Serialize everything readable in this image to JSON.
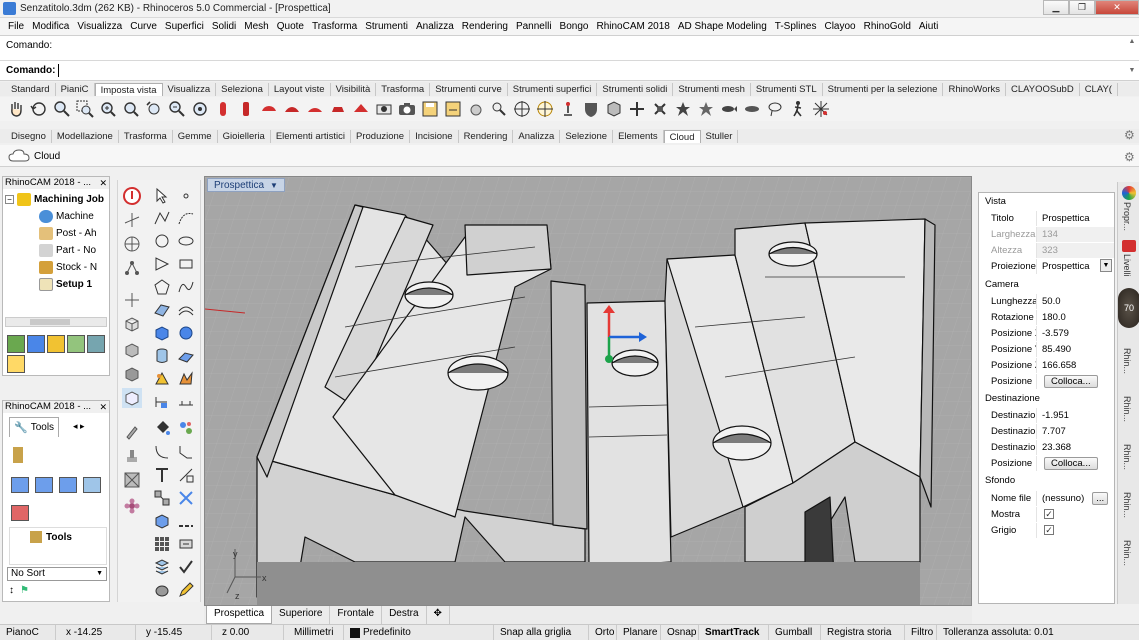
{
  "window": {
    "title": "Senzatitolo.3dm (262 KB) - Rhinoceros 5.0 Commercial - [Prospettica]"
  },
  "menu": [
    "File",
    "Modifica",
    "Visualizza",
    "Curve",
    "Superfici",
    "Solidi",
    "Mesh",
    "Quote",
    "Trasforma",
    "Strumenti",
    "Analizza",
    "Rendering",
    "Pannelli",
    "Bongo",
    "RhinoCAM 2018",
    "AD Shape Modeling",
    "T-Splines",
    "Clayoo",
    "RhinoGold",
    "Aiuti"
  ],
  "command": {
    "history": "Comando:",
    "prompt": "Comando:"
  },
  "toolbar_tabs": [
    "Standard",
    "PianiC",
    "Imposta vista",
    "Visualizza",
    "Seleziona",
    "Layout viste",
    "Visibilità",
    "Trasforma",
    "Strumenti curve",
    "Strumenti superfici",
    "Strumenti solidi",
    "Strumenti mesh",
    "Strumenti STL",
    "Strumenti per la selezione",
    "RhinoWorks",
    "CLAYOOSubD",
    "CLAY("
  ],
  "toolbar_tabs_active": "Imposta vista",
  "toolbar_tabs2": [
    "Disegno",
    "Modellazione",
    "Trasforma",
    "Gemme",
    "Gioielleria",
    "Elementi artistici",
    "Produzione",
    "Incisione",
    "Rendering",
    "Analizza",
    "Selezione",
    "Elements",
    "Cloud",
    "Stuller"
  ],
  "toolbar_tabs2_active": "Cloud",
  "cloud": {
    "label": "Cloud"
  },
  "left_panel_top": {
    "title": "RhinoCAM 2018 - ...",
    "tree": [
      {
        "label": "Machining Job",
        "bold": true
      },
      {
        "label": "Machine"
      },
      {
        "label": "Post - Ah"
      },
      {
        "label": "Part - No"
      },
      {
        "label": "Stock - N"
      },
      {
        "label": "Setup 1",
        "bold": true
      }
    ]
  },
  "left_panel_bottom": {
    "title": "RhinoCAM 2018 - ...",
    "tab": "Tools",
    "tree_label": "Tools",
    "sort": "No Sort"
  },
  "viewport": {
    "name": "Prospettica",
    "axis_y": "y",
    "axis_x": "x",
    "axis_z": "z"
  },
  "viewport_tabs": [
    "Prospettica",
    "Superiore",
    "Frontale",
    "Destra"
  ],
  "viewport_tabs_active": "Prospettica",
  "properties": {
    "section_vista": "Vista",
    "titolo_k": "Titolo",
    "titolo_v": "Prospettica",
    "larghezza_k": "Larghezza",
    "larghezza_v": "134",
    "altezza_k": "Altezza",
    "altezza_v": "323",
    "proiezione_k": "Proiezione",
    "proiezione_v": "Prospettica",
    "section_camera": "Camera",
    "lunghezza_k": "Lunghezza ...",
    "lunghezza_v": "50.0",
    "rotazione_k": "Rotazione",
    "rotazione_v": "180.0",
    "posx_k": "Posizione X",
    "posx_v": "-3.579",
    "posy_k": "Posizione Y",
    "posy_v": "85.490",
    "posz_k": "Posizione Z",
    "posz_v": "166.658",
    "pos_k": "Posizione",
    "pos_btn": "Colloca...",
    "section_dest": "Destinazione",
    "destx_k": "Destinazion...",
    "destx_v": "-1.951",
    "desty_k": "Destinazion...",
    "desty_v": "7.707",
    "destz_k": "Destinazion...",
    "destz_v": "23.368",
    "dpos_k": "Posizione",
    "dpos_btn": "Colloca...",
    "section_sfondo": "Sfondo",
    "file_k": "Nome file",
    "file_v": "(nessuno)",
    "file_btn": "...",
    "mostra_k": "Mostra",
    "grigio_k": "Grigio"
  },
  "right_strip": [
    "Propr...",
    "Livelli",
    "Rhin...",
    "Rhin...",
    "Rhin...",
    "Rhin...",
    "Rhin..."
  ],
  "right_strip_badge": "70",
  "status": {
    "plane": "PianoC",
    "x": "x -14.25",
    "y": "y -15.45",
    "z": "z 0.00",
    "units": "Millimetri",
    "layer": "Predefinito",
    "snap": "Snap alla griglia",
    "orto": "Orto",
    "planare": "Planare",
    "osnap": "Osnap",
    "smarttrack": "SmartTrack",
    "gumball": "Gumball",
    "history": "Registra storia",
    "filtro": "Filtro",
    "tolerance": "Tolleranza assoluta: 0.01"
  },
  "colors": {
    "viewport_bg": "#9e9e9e",
    "gumball_x": "#e53935",
    "gumball_y": "#1ca34a",
    "gumball_z": "#1e63d8"
  }
}
